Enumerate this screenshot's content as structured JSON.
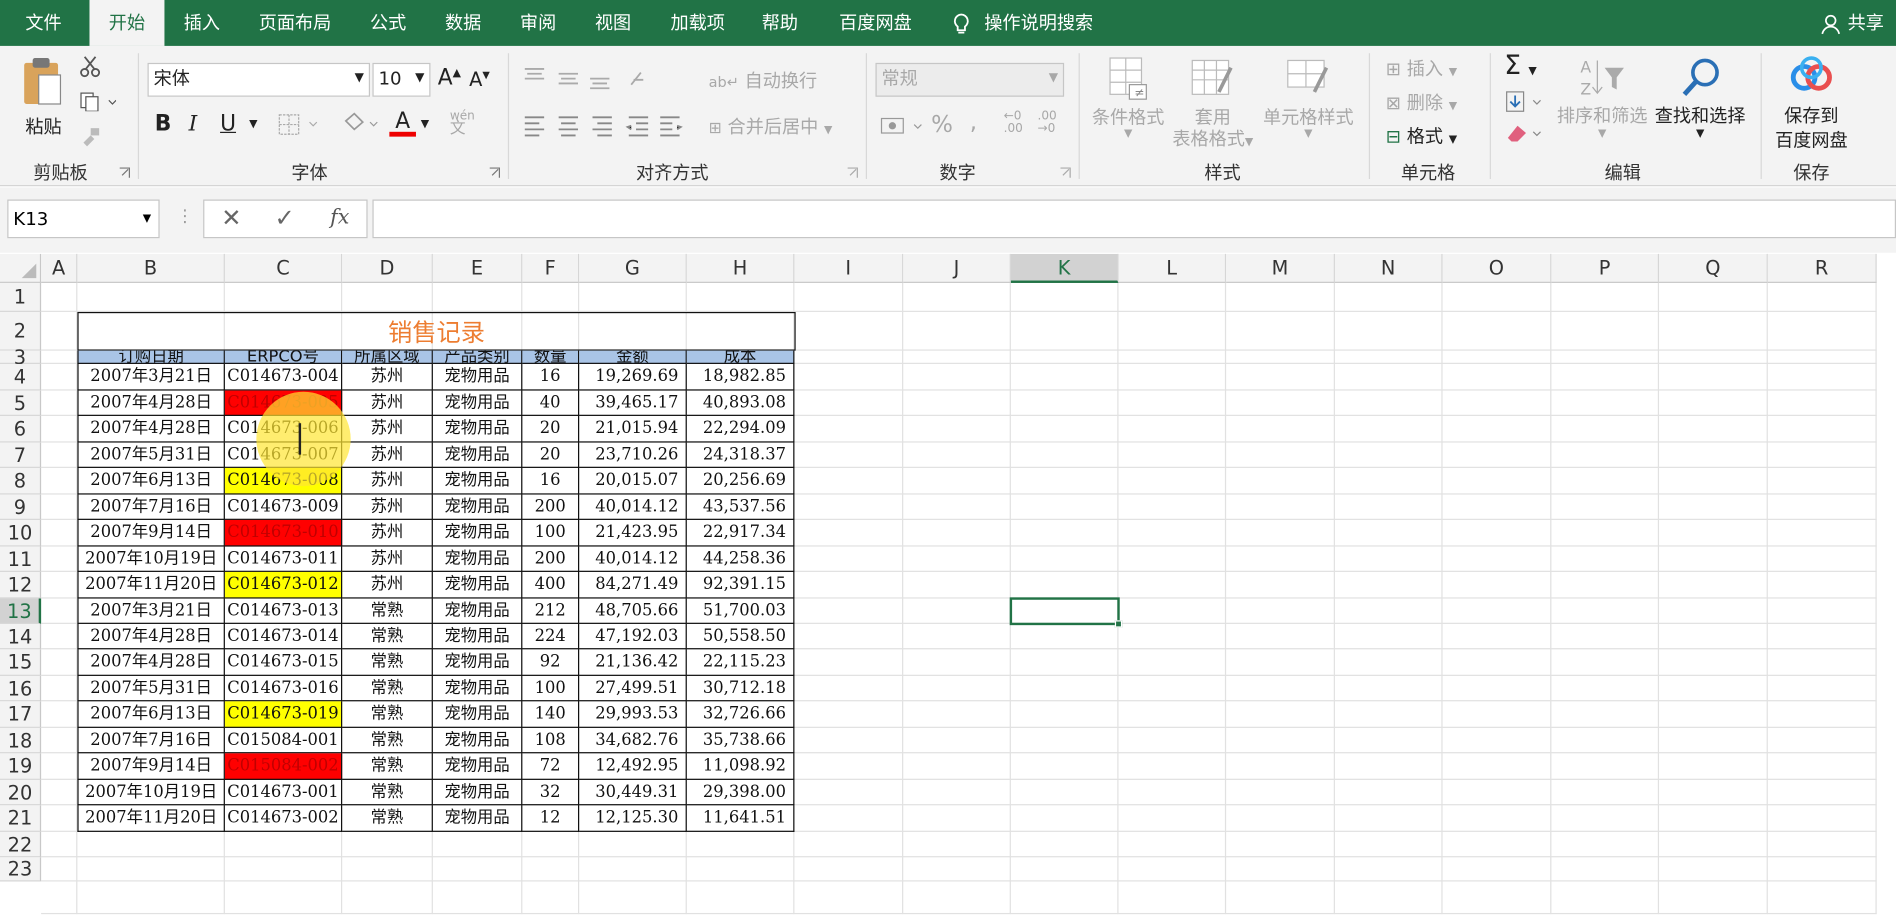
{
  "tabs": [
    "文件",
    "开始",
    "插入",
    "页面布局",
    "公式",
    "数据",
    "审阅",
    "视图",
    "加载项",
    "帮助",
    "百度网盘"
  ],
  "tell_me": "操作说明搜索",
  "share": "共享",
  "ribbon": {
    "clipboard": {
      "paste": "粘贴",
      "group": "剪贴板"
    },
    "font": {
      "name": "宋体",
      "size": "10",
      "bold": "B",
      "italic": "I",
      "underline": "U",
      "group": "字体",
      "grow": "A",
      "shrink": "A",
      "phonetic": "wén"
    },
    "align": {
      "wrap": "自动换行",
      "merge": "合并后居中",
      "group": "对齐方式"
    },
    "number": {
      "format": "常规",
      "percent": "%",
      "comma": ",",
      "group": "数字"
    },
    "styles": {
      "cond": "条件格式",
      "table1": "套用",
      "table2": "表格格式",
      "cell": "单元格样式",
      "group": "样式"
    },
    "cells": {
      "insert": "插入",
      "delete": "删除",
      "format": "格式",
      "group": "单元格"
    },
    "editing": {
      "sort": "排序和筛选",
      "find": "查找和选择",
      "group": "编辑"
    },
    "save": {
      "line1": "保存到",
      "line2": "百度网盘",
      "group": "保存"
    }
  },
  "namebox": "K13",
  "fx": "fx",
  "columns": [
    "A",
    "B",
    "C",
    "D",
    "E",
    "F",
    "G",
    "H",
    "I",
    "J",
    "K",
    "L",
    "M",
    "N",
    "O",
    "P",
    "Q",
    "R"
  ],
  "rows": [
    "1",
    "2",
    "3",
    "4",
    "5",
    "6",
    "7",
    "8",
    "9",
    "10",
    "11",
    "12",
    "13",
    "14",
    "15",
    "16",
    "17",
    "18",
    "19",
    "20",
    "21",
    "22",
    "23"
  ],
  "sheet": {
    "title": "销售记录",
    "headers": [
      "订购日期",
      "ERPCO号",
      "所属区域",
      "产品类别",
      "数量",
      "金额",
      "成本"
    ],
    "data": [
      [
        "2007年3月21日",
        "C014673-004",
        "苏州",
        "宠物用品",
        "16",
        "19,269.69",
        "18,982.85"
      ],
      [
        "2007年4月28日",
        "C014673-005",
        "苏州",
        "宠物用品",
        "40",
        "39,465.17",
        "40,893.08"
      ],
      [
        "2007年4月28日",
        "C014673-006",
        "苏州",
        "宠物用品",
        "20",
        "21,015.94",
        "22,294.09"
      ],
      [
        "2007年5月31日",
        "C014673-007",
        "苏州",
        "宠物用品",
        "20",
        "23,710.26",
        "24,318.37"
      ],
      [
        "2007年6月13日",
        "C014673-008",
        "苏州",
        "宠物用品",
        "16",
        "20,015.07",
        "20,256.69"
      ],
      [
        "2007年7月16日",
        "C014673-009",
        "苏州",
        "宠物用品",
        "200",
        "40,014.12",
        "43,537.56"
      ],
      [
        "2007年9月14日",
        "C014673-010",
        "苏州",
        "宠物用品",
        "100",
        "21,423.95",
        "22,917.34"
      ],
      [
        "2007年10月19日",
        "C014673-011",
        "苏州",
        "宠物用品",
        "200",
        "40,014.12",
        "44,258.36"
      ],
      [
        "2007年11月20日",
        "C014673-012",
        "苏州",
        "宠物用品",
        "400",
        "84,271.49",
        "92,391.15"
      ],
      [
        "2007年3月21日",
        "C014673-013",
        "常熟",
        "宠物用品",
        "212",
        "48,705.66",
        "51,700.03"
      ],
      [
        "2007年4月28日",
        "C014673-014",
        "常熟",
        "宠物用品",
        "224",
        "47,192.03",
        "50,558.50"
      ],
      [
        "2007年4月28日",
        "C014673-015",
        "常熟",
        "宠物用品",
        "92",
        "21,136.42",
        "22,115.23"
      ],
      [
        "2007年5月31日",
        "C014673-016",
        "常熟",
        "宠物用品",
        "100",
        "27,499.51",
        "30,712.18"
      ],
      [
        "2007年6月13日",
        "C014673-019",
        "常熟",
        "宠物用品",
        "140",
        "29,993.53",
        "32,726.66"
      ],
      [
        "2007年7月16日",
        "C015084-001",
        "常熟",
        "宠物用品",
        "108",
        "34,682.76",
        "35,738.66"
      ],
      [
        "2007年9月14日",
        "C015084-002",
        "常熟",
        "宠物用品",
        "72",
        "12,492.95",
        "11,098.92"
      ],
      [
        "2007年10月19日",
        "C014673-001",
        "常熟",
        "宠物用品",
        "32",
        "30,449.31",
        "29,398.00"
      ],
      [
        "2007年11月20日",
        "C014673-002",
        "常熟",
        "宠物用品",
        "12",
        "12,125.30",
        "11,641.51"
      ]
    ],
    "erp_highlight": [
      "",
      "red",
      "",
      "",
      "yellow",
      "",
      "red",
      "",
      "yellow",
      "",
      "",
      "",
      "",
      "yellow",
      "",
      "red",
      "",
      ""
    ],
    "colors": {
      "title": "#ed7d31",
      "header_bg": "#a9c4e6",
      "red": "#ff0000",
      "yellow": "#ffff00",
      "red_text": "#c00000",
      "accent": "#217346"
    }
  }
}
